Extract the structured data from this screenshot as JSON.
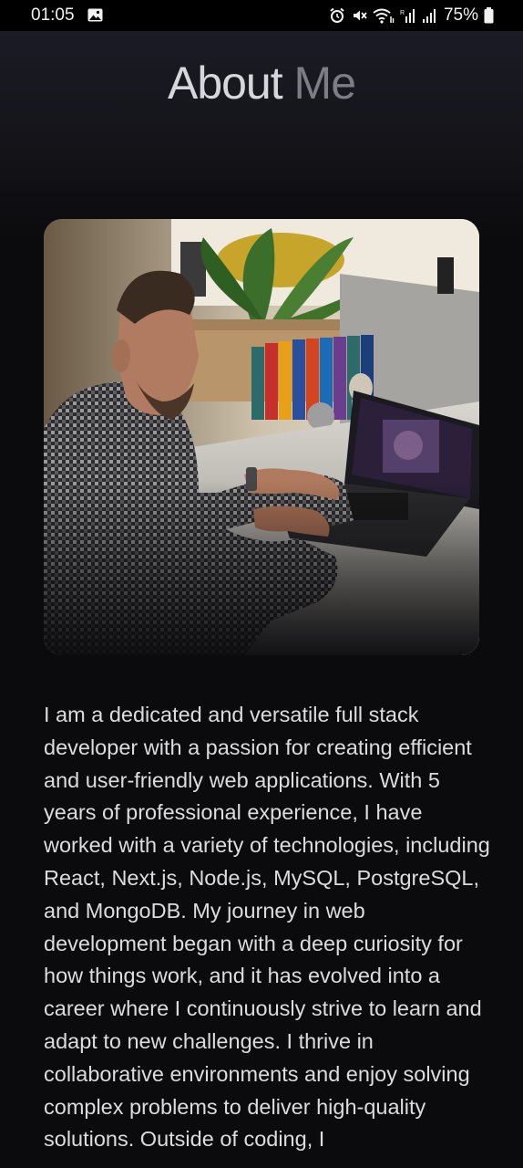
{
  "status_bar": {
    "time": "01:05",
    "battery": "75%",
    "icons": [
      "gallery-icon",
      "alarm-icon",
      "mute-icon",
      "wifi-icon",
      "signal-icon",
      "signal-icon",
      "battery-icon"
    ]
  },
  "header": {
    "title_main": "About",
    "title_accent": "Me"
  },
  "profile": {
    "photo_icon": "developer-photo"
  },
  "bio": {
    "text": "I am a dedicated and versatile full stack developer with a passion for creating efficient and user-friendly web applications. With 5 years of professional experience, I have worked with a variety of technologies, including React, Next.js, Node.js, MySQL, PostgreSQL, and MongoDB. My journey in web development began with a deep curiosity for how things work, and it has evolved into a career where I continuously strive to learn and adapt to new challenges. I thrive in collaborative environments and enjoy solving complex problems to deliver high-quality solutions. Outside of coding, I"
  },
  "colors": {
    "background": "#0b0b0e",
    "title": "#d7d7db",
    "title_accent": "#7d7d85",
    "text": "#dcdce0"
  }
}
